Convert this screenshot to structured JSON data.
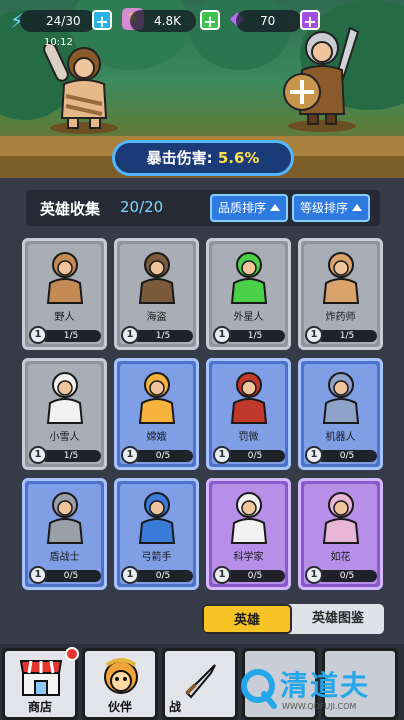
{
  "hud": {
    "energy": "24/30",
    "timer": "10:12",
    "gold": "4.8K",
    "gems": "70"
  },
  "crit": {
    "label": "暴击伤害:",
    "value": "5.6%"
  },
  "collection": {
    "title": "英雄收集",
    "count": "20/20",
    "sort_quality": "品质排序",
    "sort_level": "等级排序"
  },
  "heroes": [
    {
      "name": "野人",
      "level": "1",
      "progress": "1/5",
      "rarity": "gray"
    },
    {
      "name": "海盗",
      "level": "1",
      "progress": "1/5",
      "rarity": "gray"
    },
    {
      "name": "外星人",
      "level": "1",
      "progress": "1/5",
      "rarity": "gray"
    },
    {
      "name": "炸药师",
      "level": "1",
      "progress": "1/5",
      "rarity": "gray"
    },
    {
      "name": "小雪人",
      "level": "1",
      "progress": "1/5",
      "rarity": "gray"
    },
    {
      "name": "嫦娥",
      "level": "1",
      "progress": "0/5",
      "rarity": "blue"
    },
    {
      "name": "罚微",
      "level": "1",
      "progress": "0/5",
      "rarity": "blue"
    },
    {
      "name": "机器人",
      "level": "1",
      "progress": "0/5",
      "rarity": "blue"
    },
    {
      "name": "盾战士",
      "level": "1",
      "progress": "0/5",
      "rarity": "blue"
    },
    {
      "name": "弓箭手",
      "level": "1",
      "progress": "0/5",
      "rarity": "blue"
    },
    {
      "name": "科学家",
      "level": "1",
      "progress": "0/5",
      "rarity": "purple"
    },
    {
      "name": "如花",
      "level": "1",
      "progress": "0/5",
      "rarity": "purple"
    }
  ],
  "tabs": {
    "heroes": "英雄",
    "codex": "英雄图鉴"
  },
  "nav": {
    "shop": "商店",
    "partner": "伙伴",
    "battle": "战"
  },
  "watermark": {
    "text": "清道夫",
    "url": "WWW.QDFUJI.COM"
  },
  "colors": {
    "accent_blue": "#2f7ae0",
    "tab_yellow": "#f7c426",
    "crit_value": "#ffe24a"
  }
}
